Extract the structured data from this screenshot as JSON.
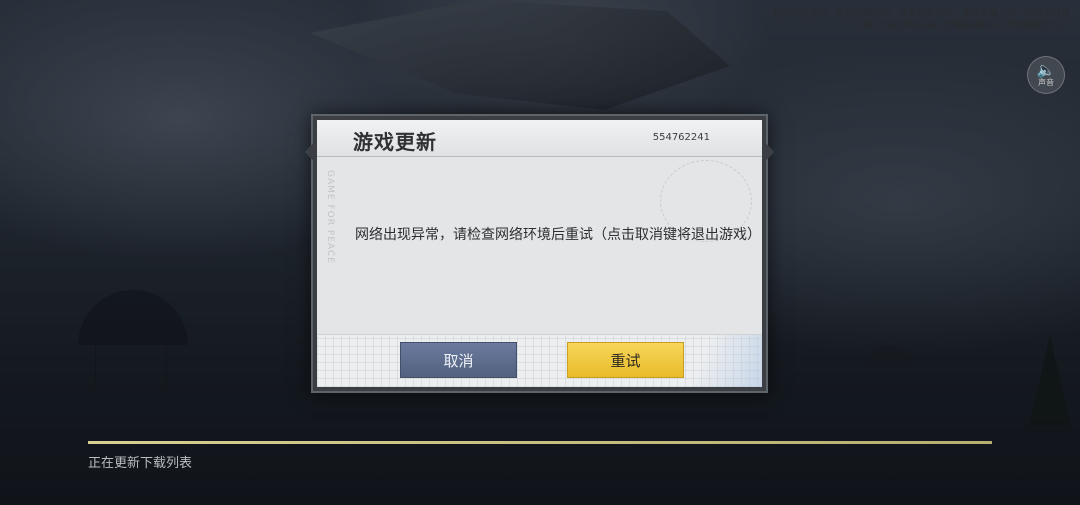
{
  "top_notice": "抵制不良游戏，拒绝盗版游戏。注意自我保护，谨防受骗上当。适度游戏益脑，沉迷游戏伤身。合理安排时间，享受健康生活。",
  "sound_button": {
    "icon": "speaker-icon",
    "label": "声音"
  },
  "dialog": {
    "title": "游戏更新",
    "id": "554762241",
    "side_decoration": "GAME FOR PEACE",
    "message": "网络出现异常，请检查网络环境后重试（点击取消键将退出游戏）",
    "cancel_label": "取消",
    "retry_label": "重试"
  },
  "loading": {
    "status_text": "正在更新下载列表",
    "progress": 1.0
  },
  "colors": {
    "cancel_button": "#5f6d8f",
    "retry_button": "#f0c83e",
    "dialog_bg": "#e3e5e7",
    "progress_fill": "#d9cf92"
  }
}
